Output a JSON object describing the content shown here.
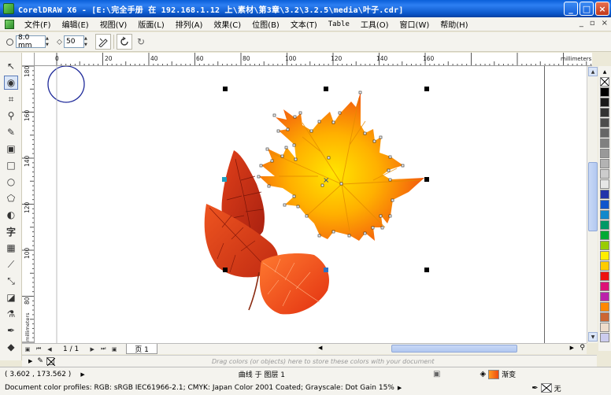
{
  "window": {
    "title": "CorelDRAW X6 - [E:\\完全手册 在 192.168.1.12 上\\素材\\第3章\\3.2\\3.2.5\\media\\叶子.cdr]",
    "minimize": "_",
    "maximize": "□",
    "close": "×"
  },
  "menu": {
    "items": [
      "文件(F)",
      "编辑(E)",
      "视图(V)",
      "版面(L)",
      "排列(A)",
      "效果(C)",
      "位图(B)",
      "文本(T)",
      "Table",
      "工具(O)",
      "窗口(W)",
      "帮助(H)"
    ],
    "mdi": [
      "_",
      "▫",
      "×"
    ]
  },
  "propbar": {
    "size_value": "8.0 mm",
    "percent_value": "50"
  },
  "rulers": {
    "top_ticks": [
      "0",
      "20",
      "40",
      "60",
      "80",
      "100",
      "120",
      "140",
      "160"
    ],
    "top_unit": "millimeters",
    "left_ticks": [
      "180",
      "160",
      "140",
      "120",
      "100",
      "80"
    ],
    "left_unit": "millimeters"
  },
  "pagenav": {
    "counter": "1 / 1",
    "tab": "页 1"
  },
  "colortray": {
    "hint": "Drag colors (or objects) here to store these colors with your document"
  },
  "status": {
    "coords": "( 3.602 , 173.562 )",
    "object_info": "曲线 于 图层 1",
    "fill_label": "渐变",
    "outline_label": "无",
    "profiles": "Document color profiles: RGB: sRGB IEC61966-2.1; CMYK: Japan Color 2001 Coated; Grayscale: Dot Gain 15%"
  },
  "palette_colors": [
    "#ffffff",
    "#000000",
    "#1a1a1a",
    "#333333",
    "#4d4d4d",
    "#666666",
    "#808080",
    "#999999",
    "#b3b3b3",
    "#cccccc",
    "#e6e6e6",
    "#2233aa",
    "#1155cc",
    "#1188cc",
    "#009966",
    "#00aa33",
    "#99cc00",
    "#ffee00",
    "#ffcc00",
    "#ee1111",
    "#dd1177",
    "#bb22aa",
    "#ff8800",
    "#cc6633",
    "#eeddcc",
    "#ccccee"
  ]
}
